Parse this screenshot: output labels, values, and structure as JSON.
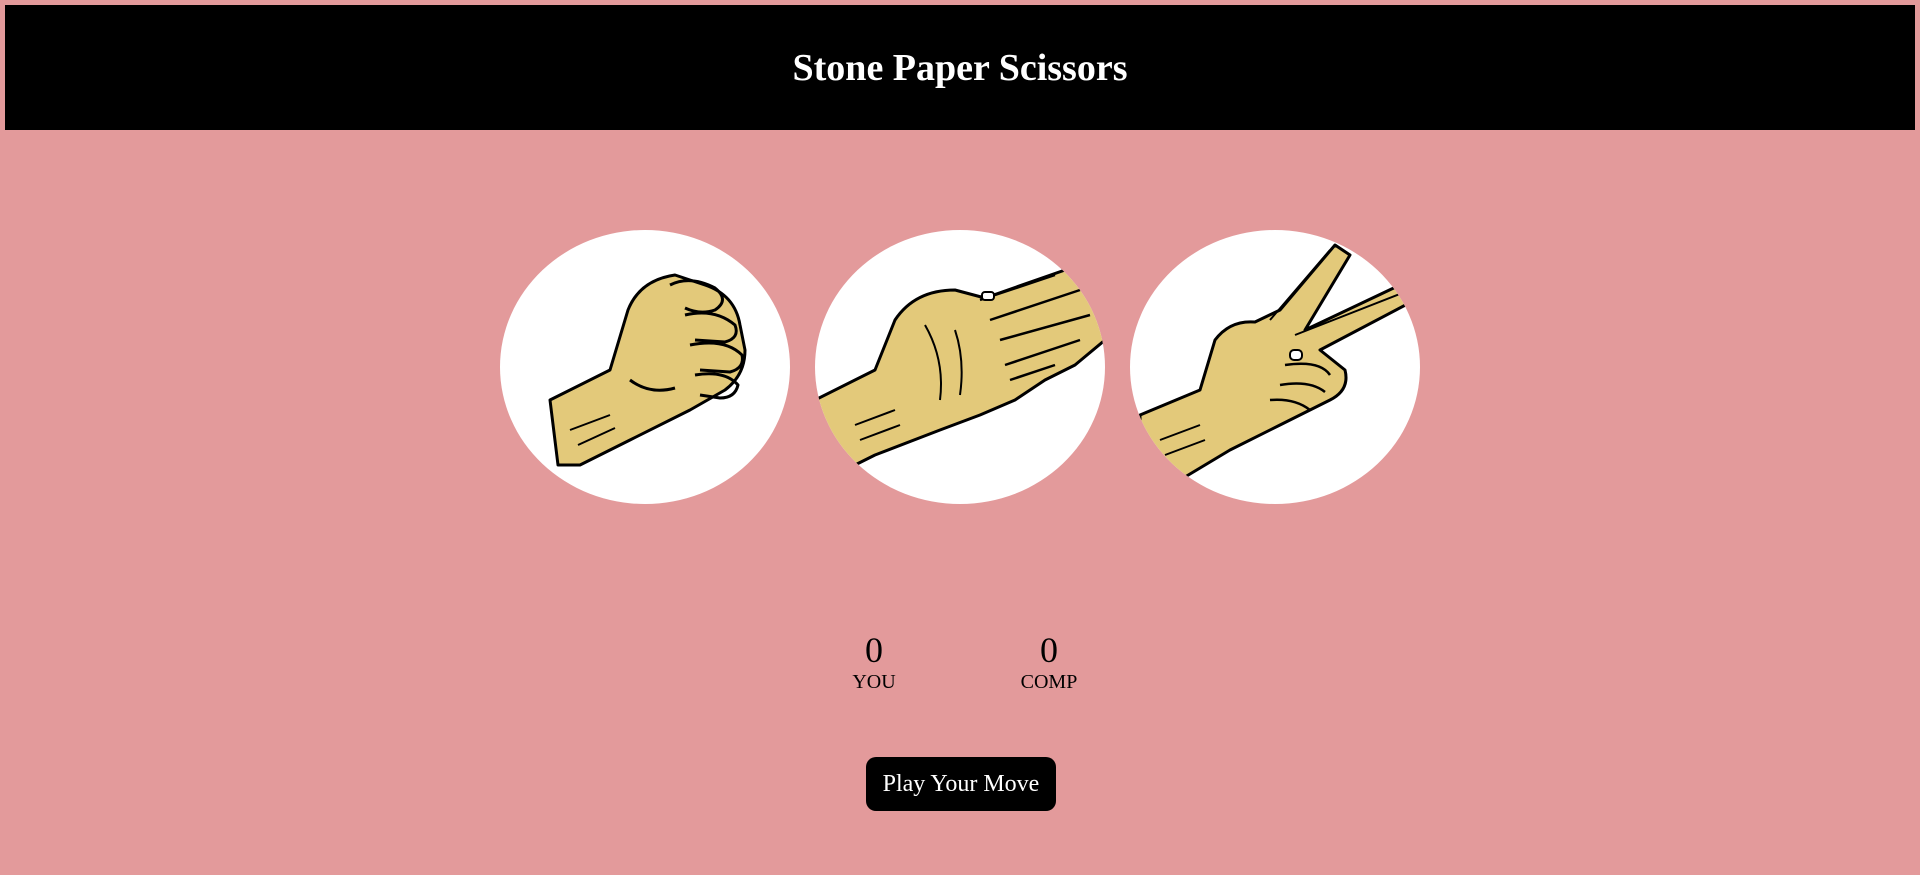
{
  "header": {
    "title": "Stone Paper Scissors"
  },
  "choices": [
    {
      "id": "stone",
      "icon": "fist-icon"
    },
    {
      "id": "paper",
      "icon": "open-hand-icon"
    },
    {
      "id": "scissors",
      "icon": "victory-hand-icon"
    }
  ],
  "scores": {
    "user": {
      "value": "0",
      "label": "YOU"
    },
    "comp": {
      "value": "0",
      "label": "COMP"
    }
  },
  "message": {
    "label": "Play Your Move"
  },
  "colors": {
    "background": "#e39a9b",
    "header": "#000000",
    "hand_fill": "#e3c97a",
    "button": "#000000"
  }
}
